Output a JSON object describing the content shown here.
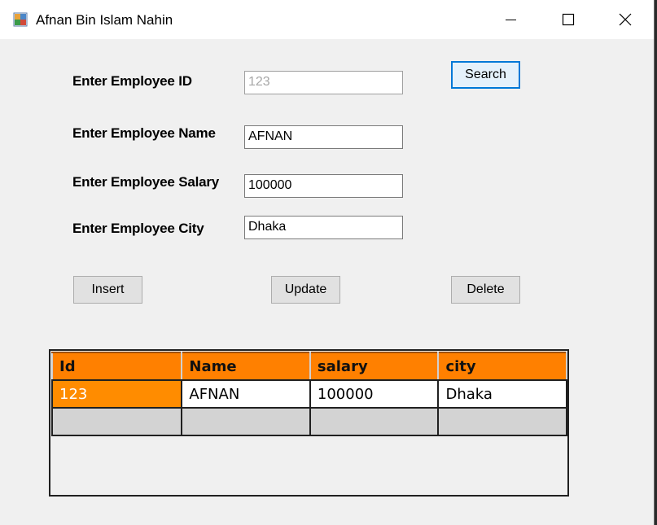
{
  "window": {
    "title": "Afnan Bin Islam Nahin",
    "icon": "winforms-app-icon"
  },
  "form": {
    "id_label": "Enter Employee ID",
    "id_value": "123",
    "name_label": "Enter Employee Name",
    "name_value": "AFNAN",
    "salary_label": "Enter Employee Salary",
    "salary_value": "100000",
    "city_label": "Enter Employee City",
    "city_value": "Dhaka"
  },
  "buttons": {
    "search": "Search",
    "insert": "Insert",
    "update": "Update",
    "delete": "Delete"
  },
  "grid": {
    "columns": [
      "Id",
      "Name",
      "salary",
      "city"
    ],
    "rows": [
      [
        "123",
        "AFNAN",
        "100000",
        "Dhaka"
      ]
    ],
    "header_color": "#ff8000",
    "selected_cell_color": "#ff8c00"
  }
}
